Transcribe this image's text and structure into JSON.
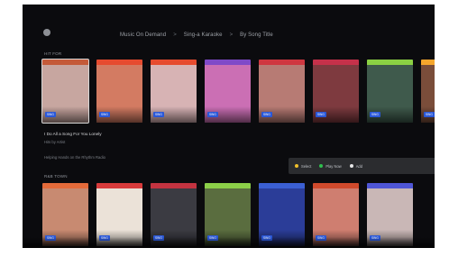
{
  "breadcrumb": {
    "items": [
      "Music On Demand",
      "Sing-a Karaoke",
      "By Song Title"
    ],
    "separator": ">"
  },
  "sections": [
    {
      "label": "HIT FOR",
      "tiles": [
        {
          "strip": "#c45a39",
          "art": "#c7a6a0",
          "tag": "SING"
        },
        {
          "strip": "#e64b2f",
          "art": "#d37b62",
          "tag": "SING"
        },
        {
          "strip": "#e64b2f",
          "art": "#d7b3b4",
          "tag": "SING"
        },
        {
          "strip": "#7f4ac8",
          "art": "#cb6fb4",
          "tag": "SING"
        },
        {
          "strip": "#cf3740",
          "art": "#b77b74",
          "tag": "SING"
        },
        {
          "strip": "#c6314a",
          "art": "#7e3a3f",
          "tag": "SING"
        },
        {
          "strip": "#8bd143",
          "art": "#3f5a4c",
          "tag": "SING"
        },
        {
          "strip": "#f6a62c",
          "art": "#7a4d3a",
          "tag": "SING"
        }
      ]
    },
    {
      "label": "R&B TOWN",
      "tiles": [
        {
          "strip": "#e46b3a",
          "art": "#c88a71",
          "tag": "SING"
        },
        {
          "strip": "#d83b3b",
          "art": "#ebe2d8",
          "tag": "SING"
        },
        {
          "strip": "#c33340",
          "art": "#3b3b42",
          "tag": "SING"
        },
        {
          "strip": "#8cd048",
          "art": "#5a6d3f",
          "tag": "SING"
        },
        {
          "strip": "#3b5fd2",
          "art": "#2b3d98",
          "tag": "SING"
        },
        {
          "strip": "#d04a2c",
          "art": "#cf7e70",
          "tag": "SING"
        },
        {
          "strip": "#4f56d6",
          "art": "#c9b7b6",
          "tag": "SING"
        }
      ]
    }
  ],
  "selected": {
    "title": "I Do All a Song For You Lonely",
    "lines": [
      "Hits by Artist",
      "Helping Hands on the Rhythm Radio"
    ]
  },
  "hints": [
    {
      "color": "#f0c02b",
      "label": "Select"
    },
    {
      "color": "#2fbf4e",
      "label": "Play Now"
    },
    {
      "color": "#e6e6e6",
      "label": "Add"
    }
  ]
}
